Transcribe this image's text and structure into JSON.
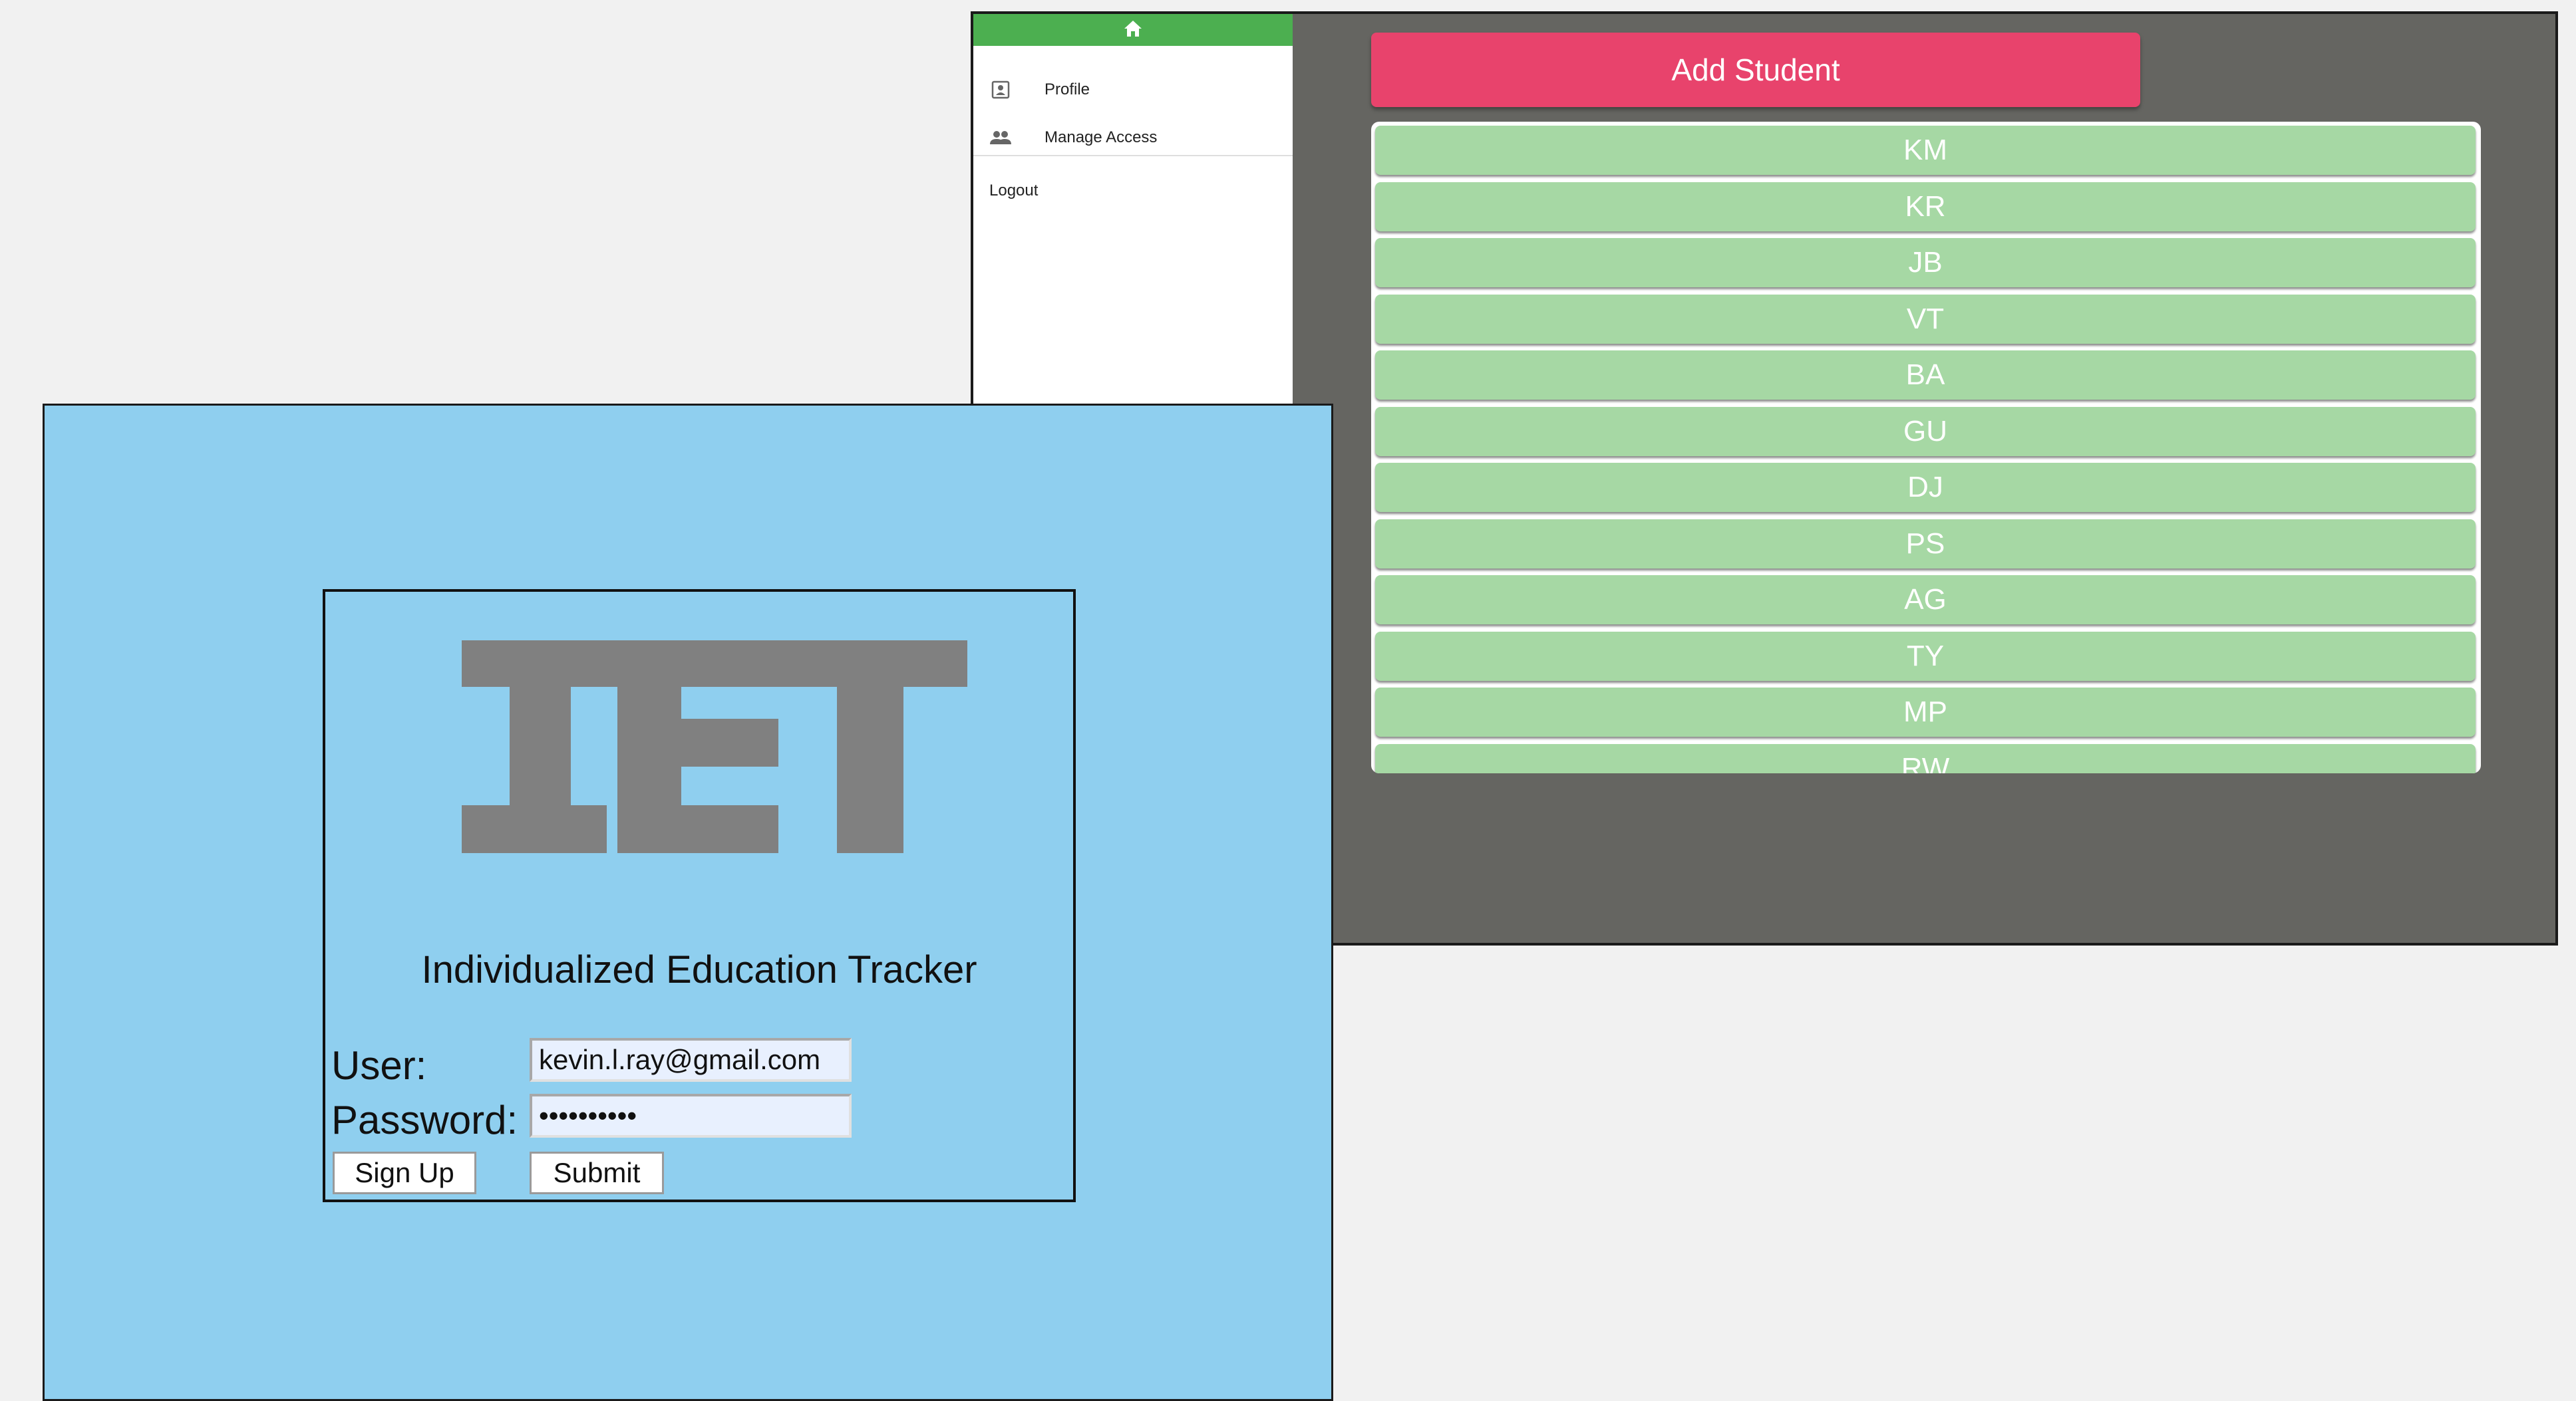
{
  "students_window": {
    "drawer": {
      "header_icon": "home-icon",
      "items": [
        {
          "label": "Profile",
          "icon": "profile-icon"
        },
        {
          "label": "Manage Access",
          "icon": "people-icon"
        }
      ],
      "logout_label": "Logout"
    },
    "add_student_label": "Add Student",
    "students": [
      "KM",
      "KR",
      "JB",
      "VT",
      "BA",
      "GU",
      "DJ",
      "PS",
      "AG",
      "TY",
      "MP",
      "RW"
    ],
    "colors": {
      "drawer_header": "#4caf50",
      "add_button": "#e8436c",
      "student_row": "#a6d8a4",
      "backdrop": "#656561"
    }
  },
  "login_window": {
    "logo_text": "IET",
    "title": "Individualized Education Tracker",
    "user_label": "User:",
    "user_value": "kevin.l.ray@gmail.com",
    "password_label": "Password:",
    "password_value": "••••••••••",
    "signup_label": "Sign Up",
    "submit_label": "Submit",
    "colors": {
      "background": "#8fcfef",
      "logo": "#808080"
    }
  }
}
